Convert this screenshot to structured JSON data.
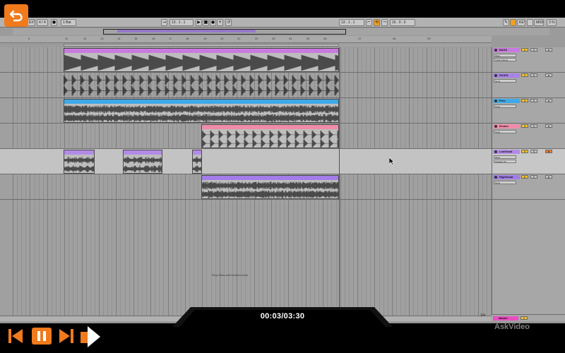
{
  "transport": {
    "tempo_mode": "EXT",
    "signature": "4 / 4",
    "quantize": "1 Bar",
    "position": "13 . 1 . 1",
    "loop_start": "13 . 1 . 1",
    "loop_length": "16 . 0 . 0",
    "key_label": "KEY",
    "midi_label": "MIDI",
    "cpu": "3 %"
  },
  "ruler": {
    "bars": [
      "9",
      "11",
      "12",
      "13",
      "14",
      "15",
      "16",
      "17",
      "18",
      "19",
      "20",
      "21",
      "22",
      "23",
      "24",
      "25",
      "26",
      "27",
      "28",
      "29"
    ]
  },
  "tracks": [
    {
      "name": "BASS",
      "color": "#c97ae0",
      "device": "Mixer",
      "param": "Track Volume",
      "number": "1",
      "armed": false
    },
    {
      "name": "KICKS",
      "color": "#a883e8",
      "device": "None",
      "param": "",
      "number": "2",
      "armed": false
    },
    {
      "name": "Perc",
      "color": "#3fa9e6",
      "device": "None",
      "param": "",
      "number": "3",
      "armed": false
    },
    {
      "name": "Drums",
      "color": "#f08ca8",
      "device": "None",
      "param": "",
      "number": "4",
      "armed": false
    },
    {
      "name": "LowVocal",
      "color": "#b28be6",
      "device": "Mixer",
      "param": "Speaker On",
      "number": "5",
      "armed": true
    },
    {
      "name": "HighVocal",
      "color": "#a27ce8",
      "device": "None",
      "param": "",
      "number": "6",
      "armed": false
    }
  ],
  "drop_hint": "Drop Files and Devices Here",
  "master": {
    "name": "Master",
    "number": "0"
  },
  "zoom_label": "1/4",
  "player": {
    "timecode": "00:03/03:30",
    "watermark": "AskVideo"
  },
  "icons": {
    "back": "back-arrow-icon",
    "prev": "skip-previous-icon",
    "pause": "pause-icon",
    "next": "skip-next-icon",
    "marker": "chapter-marker-icon"
  }
}
